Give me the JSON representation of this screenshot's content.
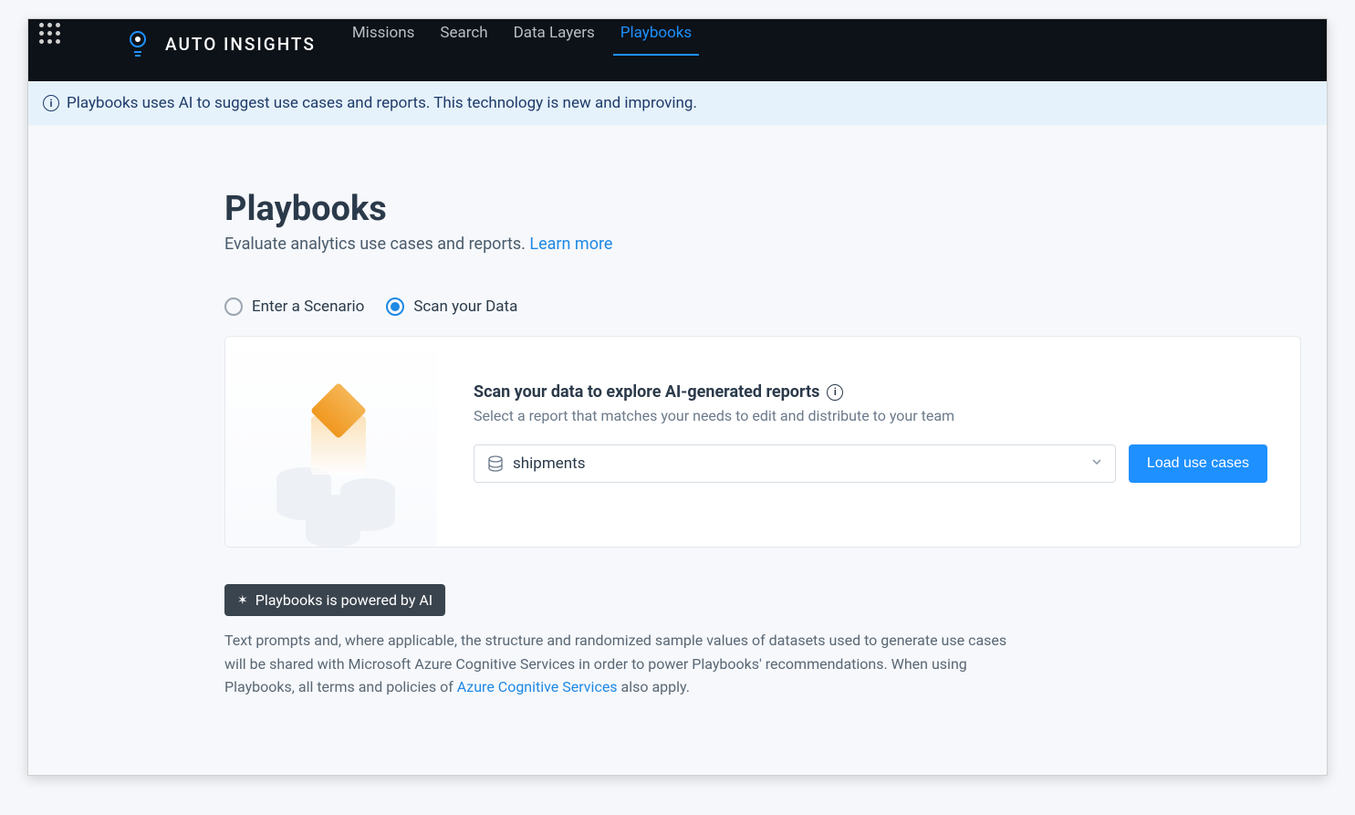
{
  "brand": "AUTO INSIGHTS",
  "nav": {
    "items": [
      {
        "label": "Missions",
        "active": false
      },
      {
        "label": "Search",
        "active": false
      },
      {
        "label": "Data Layers",
        "active": false
      },
      {
        "label": "Playbooks",
        "active": true
      }
    ]
  },
  "banner": "Playbooks uses AI to suggest use cases and reports. This technology is new and improving.",
  "page": {
    "title": "Playbooks",
    "subtitle": "Evaluate analytics use cases and reports. ",
    "learn_more": "Learn more"
  },
  "radios": {
    "enter_scenario": "Enter a Scenario",
    "scan_data": "Scan your Data",
    "selected": "scan_data"
  },
  "card": {
    "title": "Scan your data to explore AI-generated reports",
    "subtitle": "Select a report that matches your needs to edit and distribute to your team",
    "select_value": "shipments",
    "load_button": "Load use cases"
  },
  "ai_badge": "Playbooks is powered by AI",
  "disclaimer_1": "Text prompts and, where applicable, the structure and randomized sample values of datasets used to generate use cases will be shared with Microsoft Azure Cognitive Services in order to power Playbooks' recommendations. When using Playbooks, all terms and policies of ",
  "disclaimer_link": "Azure Cognitive Services",
  "disclaimer_2": " also apply."
}
